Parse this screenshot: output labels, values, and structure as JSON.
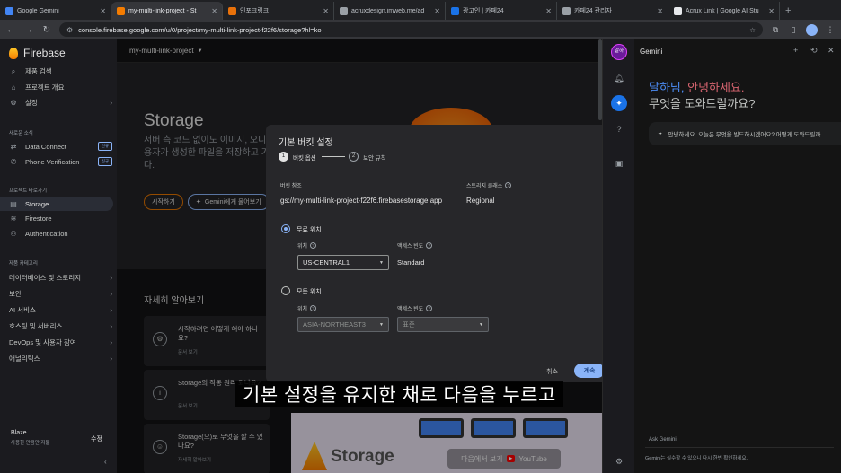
{
  "browser": {
    "tabs": [
      {
        "title": "Google Gemini",
        "color": "#4285f4"
      },
      {
        "title": "my-multi-link-project - St",
        "color": "#f57c00"
      },
      {
        "title": "인포크링크",
        "color": "#e8710a"
      },
      {
        "title": "acruxdesign.imweb.me/ad",
        "color": "#9aa0a6"
      },
      {
        "title": "광고인 | 카페24",
        "color": "#1a73e8"
      },
      {
        "title": "카페24 관리자",
        "color": "#9aa0a6"
      },
      {
        "title": "Acrux Link | Google AI Stu",
        "color": "#e8eaed"
      }
    ],
    "active_tab": 1,
    "url": "console.firebase.google.com/u/0/project/my-multi-link-project-f22f6/storage?hl=ko"
  },
  "sidebar": {
    "brand": "Firebase",
    "top_items": [
      {
        "label": "제품 검색",
        "icon": "search-icon"
      },
      {
        "label": "프로젝트 개요",
        "icon": "home-icon"
      },
      {
        "label": "설정",
        "icon": "gear-icon"
      }
    ],
    "section_new": "새로운 소식",
    "new_items": [
      {
        "label": "Data Connect",
        "badge": "신규"
      },
      {
        "label": "Phone Verification",
        "badge": "신규"
      }
    ],
    "section_shortcuts": "프로젝트 바로가기",
    "shortcut_items": [
      {
        "label": "Storage"
      },
      {
        "label": "Firestore"
      },
      {
        "label": "Authentication"
      }
    ],
    "section_categories": "제품 카테고리",
    "category_items": [
      {
        "label": "데이터베이스 및 스토리지"
      },
      {
        "label": "보안"
      },
      {
        "label": "AI 서비스"
      },
      {
        "label": "호스팅 및 서버리스"
      },
      {
        "label": "DevOps 및 사용자 참여"
      },
      {
        "label": "애널리틱스"
      }
    ],
    "plan": "Blaze",
    "plan_sub": "사용한 만큼만 지불",
    "plan_edit": "수정"
  },
  "main": {
    "project": "my-multi-link-project",
    "title": "Storage",
    "desc": "서버 측 코드 없이도 이미지, 오디 용자가 생성한 파일을 저장하고 가 다.",
    "start_btn": "시작하기",
    "gemini_btn": "Gemini에게 물어보기",
    "learn_more": "자세히 알아보기",
    "cards": [
      {
        "title": "시작하려면 어떻게 해야 하나요?",
        "sub": "문서 보기"
      },
      {
        "title": "Storage의 작동 원리 되나요?",
        "sub": "문서 보기"
      },
      {
        "title": "Storage(으)로 무엇을 할 수 있나요?",
        "sub": "자세히 알아보기"
      }
    ],
    "promo_word": "Storage",
    "promo_btn": "다음에서 보기",
    "promo_yt": "YouTube"
  },
  "dialog": {
    "title": "기본 버킷 설정",
    "step1": "버킷 옵션",
    "step2": "보안 규칙",
    "step1_num": "1",
    "step2_num": "2",
    "bucket_ref_label": "버킷 참조",
    "bucket_ref": "gs://my-multi-link-project-f22f6.firebasestorage.app",
    "storage_class_label": "스토리지 클래스",
    "storage_class": "Regional",
    "free_location": "무료 위치",
    "location_label": "위치",
    "access_label": "액세스 빈도",
    "location_value": "US-CENTRAL1",
    "access_value": "Standard",
    "all_locations": "모든 위치",
    "location_label2": "위치",
    "access_label2": "액세스 빈도",
    "location_value2": "ASIA-NORTHEAST3",
    "access_value2": "표준",
    "cancel": "취소",
    "continue": "계속"
  },
  "rail": {
    "avatar": "알하"
  },
  "gemini": {
    "title": "Gemini",
    "greet_name": "달하님,",
    "greet_hello": "안녕하세요.",
    "greet_q": "무엇을 도와드릴까요?",
    "suggestion": "안녕하세요. 오늘은 무엇을 빌드하시겠어요? 어떻게 도와드릴까",
    "ask_label": "Ask Gemini",
    "disclaimer": "Gemini는 실수할 수 있으니 다시 한번 확인하세요."
  },
  "caption": "기본 설정을 유지한 채로 다음을 누르고"
}
